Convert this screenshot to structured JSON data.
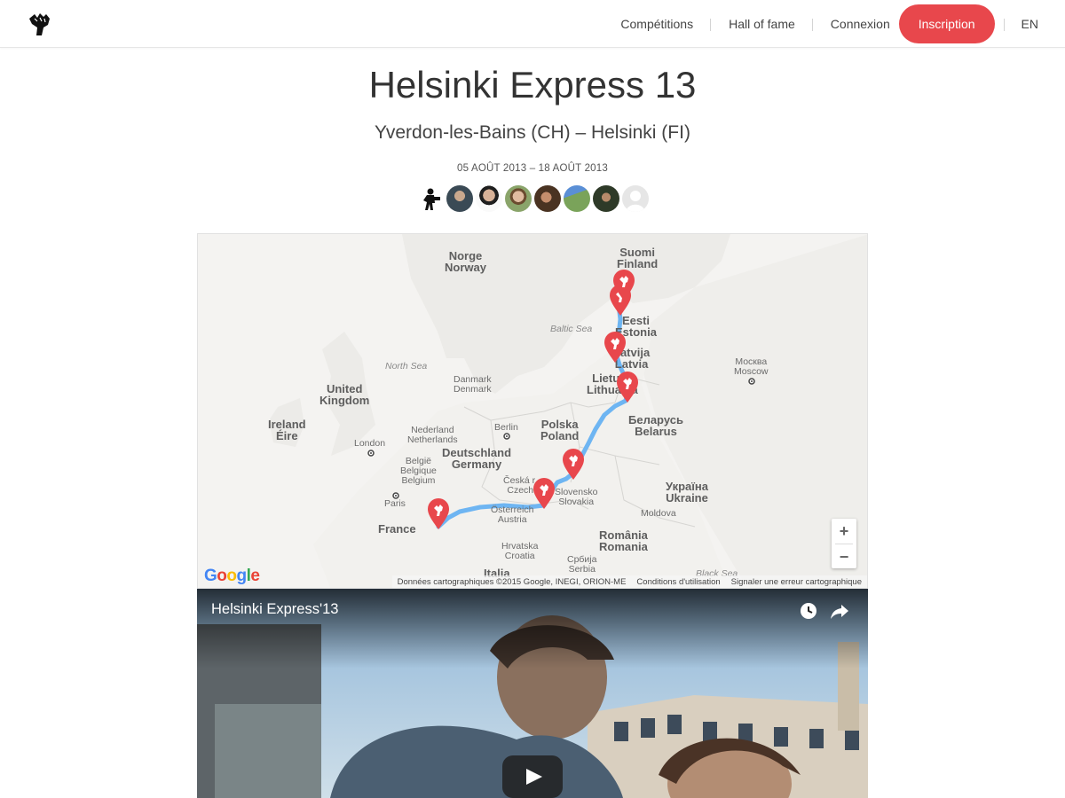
{
  "header": {
    "logo_icon": "raised-fist-logo-icon",
    "nav": {
      "competitions": "Compétitions",
      "hall_of_fame": "Hall of fame",
      "login": "Connexion",
      "signup": "Inscription",
      "language": "EN"
    },
    "accent_color": "#e8474c"
  },
  "event": {
    "title": "Helsinki Express 13",
    "route": "Yverdon-les-Bains (CH) – Helsinki (FI)",
    "dates": "05 AOÛT 2013 – 18 AOÛT 2013",
    "participants_count": 8
  },
  "map": {
    "labels": {
      "norway": "Norge\nNorway",
      "finland": "Suomi\nFinland",
      "estonia": "Eesti\nEstonia",
      "latvia": "Latvija\nLatvia",
      "lithuania": "Lietuva\nLithuania",
      "belarus": "Беларусь\nBelarus",
      "poland": "Polska\nPoland",
      "germany": "Deutschland\nGermany",
      "uk": "United\nKingdom",
      "ireland": "Ireland\nÉire",
      "netherlands": "Nederland\nNetherlands",
      "belgium": "België\nBelgique\nBelgium",
      "denmark": "Danmark\nDenmark",
      "czech": "Česká r.\nCzech",
      "slovakia": "Slovensko\nSlovakia",
      "austria": "Österreich\nAustria",
      "ukraine": "Україна\nUkraine",
      "moldova": "Moldova",
      "romania": "România\nRomania",
      "croatia": "Hrvatska\nCroatia",
      "serbia": "Србија\nSerbia",
      "france": "France",
      "italy": "Italia",
      "north_sea": "North Sea",
      "baltic_sea": "Baltic Sea",
      "black_sea": "Black Sea",
      "berlin": "Berlin",
      "london": "London",
      "paris": "Paris",
      "moscow": "Москва\nMoscow"
    },
    "zoom_in": "+",
    "zoom_out": "−",
    "google_logo": "Google",
    "attribution": "Données cartographiques ©2015 Google, INEGI, ORION-ME",
    "terms": "Conditions d'utilisation",
    "report": "Signaler une erreur cartographique",
    "route_color": "#6eb5f2",
    "marker_color": "#e8474c"
  },
  "video": {
    "title": "Helsinki Express'13",
    "watch_later_icon": "clock-icon",
    "share_icon": "share-arrow-icon",
    "play_icon": "play-icon"
  }
}
